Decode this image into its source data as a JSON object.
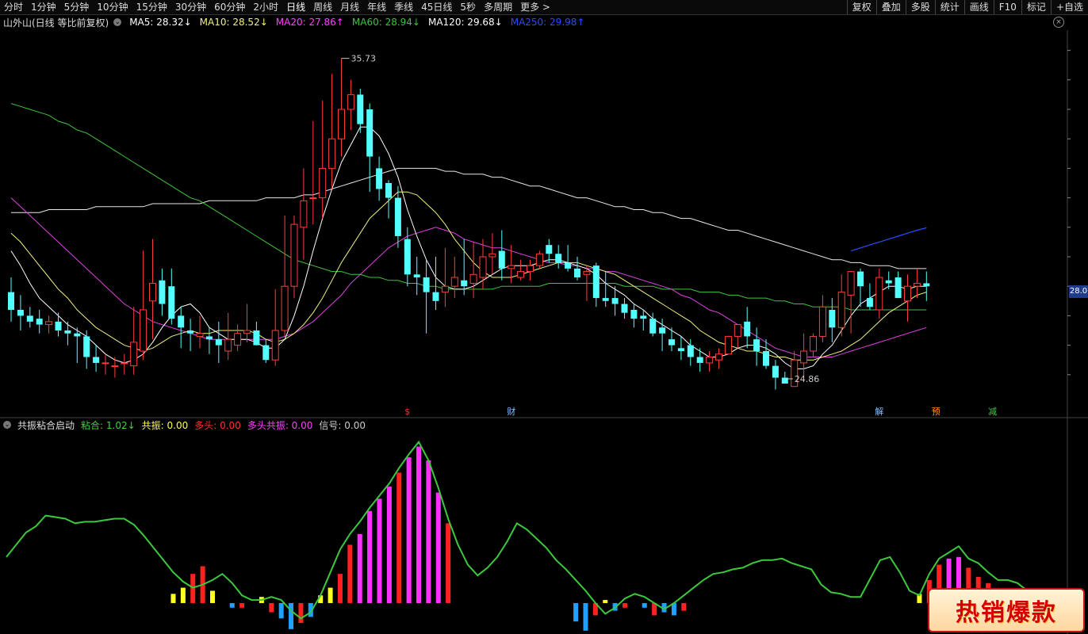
{
  "toolbar": {
    "left_tabs": [
      "分时",
      "1分钟",
      "5分钟",
      "10分钟",
      "15分钟",
      "30分钟",
      "60分钟",
      "2小时",
      "日线",
      "周线",
      "月线",
      "年线",
      "季线",
      "45日线",
      "5秒",
      "多周期",
      "更多 >"
    ],
    "selected_tab": "日线",
    "right_tabs": [
      "复权",
      "叠加",
      "多股",
      "统计",
      "画线",
      "F10",
      "标记",
      "+自选"
    ]
  },
  "legend": {
    "name": "山外山(日线 等比前复权)",
    "ma5": "MA5: 28.32↓",
    "ma10": "MA10: 28.52↓",
    "ma20": "MA20: 27.86↑",
    "ma60": "MA60: 28.94↓",
    "ma120": "MA120: 29.68↓",
    "ma250": "MA250: 29.98↑",
    "close_btn": "×",
    "colors": {
      "ma5": "#ffffff",
      "ma10": "#f0f080",
      "ma20": "#ff40ff",
      "ma60": "#40c040",
      "ma120": "#ffffff",
      "ma250": "#2040ff"
    }
  },
  "price_tag": "28.0",
  "high_label": "35.73",
  "low_label": "24.86",
  "markers": [
    "$",
    "财",
    "解",
    "预",
    "减"
  ],
  "indicator": {
    "name": "共振粘合启动",
    "nianhe": "粘合: 1.02↓",
    "gongzhen": "共振: 0.00",
    "duotou": "多头: 0.00",
    "duotou_gongzhen": "多头共振: 0.00",
    "xinhao": "信号: 0.00"
  },
  "badge": "热销爆款",
  "chart_data": {
    "type": "candlestick",
    "open": [
      27.8,
      27.2,
      27.0,
      26.9,
      26.7,
      26.8,
      26.5,
      26.4,
      26.3,
      25.6,
      25.4,
      25.3,
      25.4,
      25.3,
      25.8,
      27.5,
      28.2,
      28.0,
      27.0,
      26.5,
      26.3,
      26.3,
      26.2,
      25.8,
      26.0,
      26.4,
      26.5,
      26.0,
      25.5,
      26.5,
      28.0,
      30.0,
      31.0,
      31.0,
      32.0,
      33.0,
      34.0,
      34.5,
      34.0,
      32.0,
      31.5,
      31.0,
      29.6,
      28.4,
      28.3,
      27.8,
      27.8,
      28.0,
      28.2,
      28.1,
      28.3,
      29.0,
      29.2,
      28.6,
      28.3,
      28.5,
      28.7,
      29.4,
      29.1,
      28.8,
      28.6,
      28.4,
      28.7,
      27.6,
      27.6,
      27.4,
      27.2,
      27.0,
      26.9,
      26.6,
      26.2,
      25.9,
      26.0,
      25.6,
      25.4,
      25.5,
      25.7,
      26.3,
      26.8,
      26.2,
      25.8,
      25.3,
      24.9,
      24.6,
      25.4,
      25.8,
      26.3,
      27.2,
      26.6,
      27.7,
      28.5,
      27.6,
      27.2,
      28.2,
      28.3,
      27.5,
      28.0,
      28.1
    ],
    "high": [
      28.3,
      27.7,
      27.3,
      27.2,
      27.0,
      27.1,
      26.8,
      26.6,
      26.5,
      26.0,
      25.7,
      25.6,
      25.7,
      27.3,
      29.2,
      29.6,
      28.6,
      28.6,
      27.3,
      26.9,
      27.0,
      26.6,
      26.8,
      27.1,
      26.7,
      27.4,
      26.8,
      26.2,
      27.9,
      30.4,
      30.4,
      32.0,
      33.6,
      34.3,
      35.2,
      35.73,
      35.0,
      34.7,
      34.2,
      32.4,
      31.6,
      31.4,
      30.0,
      29.0,
      28.9,
      29.0,
      29.3,
      29.0,
      29.6,
      29.5,
      29.6,
      29.8,
      29.9,
      29.4,
      28.9,
      28.9,
      29.2,
      29.6,
      29.4,
      29.4,
      29.0,
      28.7,
      28.8,
      28.5,
      28.0,
      27.6,
      27.4,
      27.2,
      27.1,
      26.9,
      26.6,
      26.3,
      26.2,
      25.9,
      25.8,
      25.9,
      26.3,
      26.7,
      27.3,
      26.6,
      26.2,
      25.5,
      25.1,
      25.8,
      26.4,
      26.4,
      27.7,
      27.6,
      28.4,
      28.4,
      28.6,
      28.1,
      28.6,
      28.5,
      28.5,
      28.4,
      28.6,
      28.5
    ],
    "low": [
      26.8,
      26.5,
      26.6,
      26.4,
      26.4,
      26.3,
      26.0,
      25.4,
      25.2,
      25.1,
      25.0,
      24.9,
      25.0,
      25.0,
      25.5,
      26.2,
      27.0,
      26.7,
      25.9,
      25.8,
      25.9,
      25.7,
      25.4,
      25.5,
      25.8,
      26.1,
      26.0,
      25.4,
      25.3,
      26.3,
      27.6,
      28.9,
      30.1,
      30.3,
      31.3,
      32.4,
      33.3,
      33.2,
      31.2,
      30.9,
      30.3,
      29.3,
      28.0,
      27.7,
      26.4,
      27.2,
      27.3,
      27.6,
      27.7,
      27.6,
      27.9,
      28.4,
      28.2,
      28.1,
      28.2,
      28.2,
      28.6,
      28.8,
      28.6,
      28.5,
      28.2,
      27.5,
      27.3,
      27.3,
      27.0,
      26.9,
      26.6,
      26.5,
      26.3,
      25.8,
      25.8,
      25.5,
      25.3,
      25.1,
      25.1,
      25.2,
      25.7,
      25.9,
      25.9,
      25.3,
      25.2,
      24.5,
      24.86,
      24.6,
      24.9,
      25.6,
      26.1,
      26.1,
      26.3,
      26.4,
      27.3,
      27.2,
      26.9,
      27.9,
      27.6,
      26.8,
      27.6,
      27.5
    ],
    "close": [
      27.2,
      27.0,
      26.8,
      26.7,
      26.8,
      26.5,
      26.4,
      26.3,
      25.6,
      25.4,
      25.4,
      25.3,
      25.4,
      26.1,
      27.2,
      28.1,
      27.4,
      26.9,
      26.6,
      26.4,
      26.4,
      26.2,
      26.0,
      26.2,
      26.4,
      26.5,
      26.0,
      25.5,
      26.5,
      28.0,
      30.1,
      30.9,
      31.0,
      32.0,
      33.0,
      34.0,
      34.5,
      33.5,
      32.4,
      31.3,
      31.0,
      29.7,
      28.4,
      28.3,
      27.8,
      27.5,
      28.0,
      28.3,
      28.0,
      28.4,
      29.0,
      29.1,
      28.6,
      28.7,
      28.5,
      28.7,
      29.1,
      29.1,
      28.8,
      28.6,
      28.3,
      28.5,
      27.6,
      27.5,
      27.4,
      27.1,
      26.9,
      26.9,
      26.4,
      26.4,
      26.0,
      25.8,
      25.6,
      25.4,
      25.6,
      25.7,
      26.3,
      26.7,
      26.3,
      25.8,
      25.3,
      24.9,
      24.7,
      25.5,
      25.8,
      26.3,
      27.3,
      26.6,
      27.8,
      28.5,
      28.0,
      27.3,
      28.3,
      28.1,
      27.6,
      28.0,
      28.1,
      28.0
    ],
    "ma5": [
      29.2,
      28.7,
      28.1,
      27.6,
      27.3,
      27.0,
      26.7,
      26.5,
      26.3,
      26.0,
      25.7,
      25.5,
      25.4,
      25.5,
      25.7,
      26.1,
      26.6,
      27.0,
      27.3,
      27.4,
      27.1,
      26.6,
      26.4,
      26.2,
      26.2,
      26.2,
      26.1,
      25.9,
      25.9,
      26.2,
      27.0,
      28.0,
      29.2,
      30.3,
      31.3,
      32.2,
      32.8,
      33.4,
      33.4,
      33.1,
      32.5,
      31.7,
      30.6,
      29.7,
      28.9,
      28.3,
      28.0,
      27.9,
      27.9,
      28.0,
      28.2,
      28.4,
      28.6,
      28.7,
      28.7,
      28.7,
      28.8,
      28.9,
      28.9,
      28.8,
      28.7,
      28.6,
      28.4,
      28.1,
      27.9,
      27.7,
      27.4,
      27.2,
      26.9,
      26.7,
      26.5,
      26.3,
      26.0,
      25.8,
      25.6,
      25.6,
      25.7,
      25.9,
      26.0,
      26.0,
      25.9,
      25.7,
      25.4,
      25.2,
      25.2,
      25.3,
      25.7,
      26.0,
      26.5,
      27.0,
      27.4,
      27.6,
      27.8,
      28.0,
      28.0,
      27.9,
      28.0,
      28.0
    ],
    "ma10": [
      29.8,
      29.5,
      29.1,
      28.7,
      28.3,
      27.9,
      27.6,
      27.2,
      26.9,
      26.6,
      26.4,
      26.2,
      26.0,
      25.9,
      25.8,
      25.9,
      26.1,
      26.3,
      26.4,
      26.5,
      26.4,
      26.4,
      26.5,
      26.5,
      26.5,
      26.5,
      26.4,
      26.2,
      26.1,
      26.2,
      26.4,
      26.7,
      27.1,
      27.6,
      28.2,
      28.8,
      29.3,
      29.8,
      30.3,
      30.6,
      30.9,
      31.2,
      31.2,
      31.1,
      30.8,
      30.5,
      30.1,
      29.6,
      29.2,
      28.8,
      28.5,
      28.3,
      28.3,
      28.3,
      28.4,
      28.5,
      28.6,
      28.7,
      28.8,
      28.8,
      28.8,
      28.7,
      28.6,
      28.5,
      28.4,
      28.2,
      28.0,
      27.8,
      27.6,
      27.4,
      27.2,
      27.0,
      26.8,
      26.5,
      26.3,
      26.1,
      26.0,
      25.9,
      25.8,
      25.8,
      25.7,
      25.6,
      25.6,
      25.5,
      25.5,
      25.5,
      25.6,
      25.7,
      25.8,
      26.0,
      26.2,
      26.5,
      26.8,
      27.1,
      27.3,
      27.5,
      27.7,
      27.8
    ],
    "ma20": [
      31.0,
      30.7,
      30.4,
      30.1,
      29.8,
      29.5,
      29.2,
      28.9,
      28.6,
      28.3,
      28.0,
      27.7,
      27.4,
      27.2,
      27.0,
      26.8,
      26.7,
      26.6,
      26.5,
      26.4,
      26.3,
      26.2,
      26.2,
      26.2,
      26.2,
      26.2,
      26.2,
      26.2,
      26.2,
      26.3,
      26.4,
      26.6,
      26.8,
      27.1,
      27.4,
      27.7,
      28.1,
      28.4,
      28.7,
      29.0,
      29.3,
      29.5,
      29.7,
      29.8,
      29.9,
      30.0,
      29.9,
      29.8,
      29.6,
      29.5,
      29.4,
      29.3,
      29.3,
      29.2,
      29.1,
      29.0,
      28.9,
      28.8,
      28.8,
      28.7,
      28.7,
      28.6,
      28.6,
      28.5,
      28.5,
      28.4,
      28.3,
      28.2,
      28.1,
      28.0,
      27.9,
      27.7,
      27.6,
      27.4,
      27.2,
      27.1,
      26.9,
      26.7,
      26.5,
      26.3,
      26.1,
      25.9,
      25.8,
      25.7,
      25.6,
      25.6,
      25.6,
      25.6,
      25.7,
      25.8,
      25.9,
      26.0,
      26.1,
      26.2,
      26.3,
      26.4,
      26.5,
      26.6
    ],
    "ma60": [
      34.2,
      34.1,
      34.0,
      33.9,
      33.8,
      33.6,
      33.5,
      33.3,
      33.2,
      33.0,
      32.8,
      32.6,
      32.4,
      32.2,
      32.0,
      31.8,
      31.6,
      31.4,
      31.2,
      31.0,
      30.9,
      30.7,
      30.5,
      30.3,
      30.1,
      29.9,
      29.7,
      29.5,
      29.3,
      29.1,
      28.9,
      28.8,
      28.7,
      28.6,
      28.5,
      28.5,
      28.4,
      28.4,
      28.3,
      28.3,
      28.2,
      28.2,
      28.1,
      28.1,
      28.0,
      28.0,
      27.9,
      27.9,
      27.9,
      27.9,
      27.9,
      27.9,
      28.0,
      28.0,
      28.0,
      28.0,
      28.0,
      28.1,
      28.1,
      28.1,
      28.1,
      28.1,
      28.1,
      28.1,
      28.1,
      28.0,
      28.0,
      28.0,
      28.0,
      27.9,
      27.9,
      27.9,
      27.9,
      27.8,
      27.8,
      27.8,
      27.7,
      27.7,
      27.6,
      27.6,
      27.6,
      27.5,
      27.5,
      27.4,
      27.4,
      27.3,
      27.3,
      27.3,
      27.3,
      27.2,
      27.2,
      27.2,
      27.2,
      27.2,
      27.2,
      27.2,
      27.2,
      27.2
    ],
    "ma120": [
      30.5,
      30.5,
      30.5,
      30.5,
      30.6,
      30.6,
      30.6,
      30.6,
      30.6,
      30.7,
      30.7,
      30.7,
      30.7,
      30.7,
      30.7,
      30.8,
      30.8,
      30.8,
      30.8,
      30.8,
      30.8,
      30.9,
      30.9,
      30.9,
      30.9,
      30.9,
      30.9,
      31.0,
      31.0,
      31.0,
      31.0,
      31.1,
      31.1,
      31.2,
      31.3,
      31.4,
      31.5,
      31.6,
      31.7,
      31.8,
      31.9,
      32.0,
      32.0,
      32.0,
      32.0,
      32.0,
      31.9,
      31.9,
      31.8,
      31.8,
      31.8,
      31.7,
      31.7,
      31.6,
      31.5,
      31.4,
      31.4,
      31.3,
      31.2,
      31.1,
      31.0,
      31.0,
      30.9,
      30.8,
      30.7,
      30.7,
      30.6,
      30.6,
      30.5,
      30.5,
      30.4,
      30.3,
      30.3,
      30.2,
      30.1,
      30.0,
      29.9,
      29.9,
      29.8,
      29.7,
      29.6,
      29.5,
      29.4,
      29.3,
      29.2,
      29.1,
      29.0,
      28.9,
      28.9,
      28.8,
      28.8,
      28.7,
      28.7,
      28.7,
      28.6,
      28.6,
      28.6,
      28.6
    ],
    "ma250": [
      29.2,
      29.3,
      29.4,
      29.5,
      29.6,
      29.7,
      29.8,
      29.9,
      29.98
    ],
    "ylim": [
      24.0,
      36.5
    ],
    "high_index": 35,
    "low_index": 82,
    "marker_index": [
      42,
      53,
      92,
      98,
      104
    ],
    "osc": {
      "line": [
        0.3,
        0.38,
        0.46,
        0.5,
        0.57,
        0.56,
        0.55,
        0.52,
        0.53,
        0.53,
        0.54,
        0.55,
        0.55,
        0.51,
        0.44,
        0.36,
        0.28,
        0.2,
        0.14,
        0.1,
        0.12,
        0.15,
        0.19,
        0.13,
        0.05,
        0.02,
        0.02,
        0.04,
        0.02,
        -0.05,
        -0.1,
        -0.06,
        0.05,
        0.2,
        0.35,
        0.45,
        0.53,
        0.62,
        0.7,
        0.78,
        0.88,
        0.97,
        1.05,
        0.93,
        0.75,
        0.55,
        0.38,
        0.25,
        0.18,
        0.23,
        0.3,
        0.4,
        0.52,
        0.48,
        0.42,
        0.36,
        0.28,
        0.22,
        0.15,
        0.08,
        0.0,
        -0.07,
        -0.03,
        0.03,
        0.06,
        0.04,
        0.0,
        -0.04,
        0.0,
        0.05,
        0.1,
        0.15,
        0.19,
        0.2,
        0.22,
        0.23,
        0.26,
        0.28,
        0.28,
        0.29,
        0.26,
        0.24,
        0.22,
        0.12,
        0.07,
        0.06,
        0.04,
        0.04,
        0.16,
        0.28,
        0.3,
        0.2,
        0.08,
        0.05,
        0.19,
        0.29,
        0.33,
        0.37,
        0.29,
        0.26,
        0.2,
        0.15,
        0.15,
        0.13,
        0.08,
        0.0
      ],
      "bars": [
        0,
        0,
        0,
        0,
        0,
        0,
        0,
        0,
        0,
        0,
        0,
        0,
        0,
        0,
        0,
        0,
        0,
        0.06,
        0.1,
        0.19,
        0.24,
        0.08,
        0,
        -0.03,
        -0.03,
        0,
        0.04,
        -0.06,
        -0.1,
        -0.17,
        -0.13,
        -0.09,
        0.05,
        0.1,
        0.19,
        0.38,
        0.45,
        0.6,
        0.68,
        0.76,
        0.85,
        0.95,
        1.02,
        0.93,
        0.72,
        0.52,
        0,
        0,
        0,
        0,
        0,
        0,
        0,
        0,
        0,
        0,
        0,
        0,
        -0.12,
        -0.18,
        -0.08,
        0.02,
        -0.05,
        -0.03,
        0.0,
        -0.03,
        -0.08,
        -0.06,
        -0.08,
        -0.05,
        0,
        0,
        0,
        0,
        0,
        0,
        0,
        0,
        0,
        0,
        0,
        0,
        0,
        0,
        0,
        0,
        0,
        0,
        0,
        0,
        0,
        0,
        0,
        0.06,
        0.15,
        0.25,
        0.29,
        0.3,
        0.23,
        0.17,
        0.13,
        0,
        0,
        0,
        0,
        0
      ],
      "ylim": [
        -0.15,
        1.1
      ]
    }
  }
}
